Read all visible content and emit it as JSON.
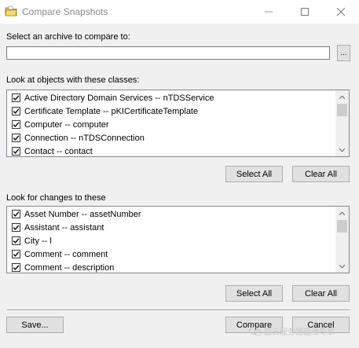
{
  "window": {
    "title": "Compare Snapshots",
    "icon": "folder-icon"
  },
  "archive": {
    "label": "Select an archive to compare to:",
    "value": "",
    "browse_label": "..."
  },
  "classes": {
    "label": "Look at objects with these classes:",
    "items": [
      {
        "text": "Active Directory Domain Services  --  nTDSService",
        "checked": true
      },
      {
        "text": "Certificate Template  --  pKICertificateTemplate",
        "checked": true
      },
      {
        "text": "Computer  --  computer",
        "checked": true
      },
      {
        "text": "Connection  --  nTDSConnection",
        "checked": true
      },
      {
        "text": "Contact  --  contact",
        "checked": true
      }
    ],
    "select_all_label": "Select All",
    "clear_all_label": "Clear All"
  },
  "changes": {
    "label": "Look for changes to these",
    "items": [
      {
        "text": "Asset Number  --  assetNumber",
        "checked": true
      },
      {
        "text": "Assistant  --  assistant",
        "checked": true
      },
      {
        "text": "City  --  l",
        "checked": true
      },
      {
        "text": "Comment  --  comment",
        "checked": true
      },
      {
        "text": "Comment  --  description",
        "checked": true
      }
    ],
    "select_all_label": "Select All",
    "clear_all_label": "Clear All"
  },
  "footer": {
    "save_label": "Save...",
    "compare_label": "Compare",
    "cancel_label": "Cancel"
  },
  "watermark": {
    "text": "蓝云服务器运维专家"
  }
}
